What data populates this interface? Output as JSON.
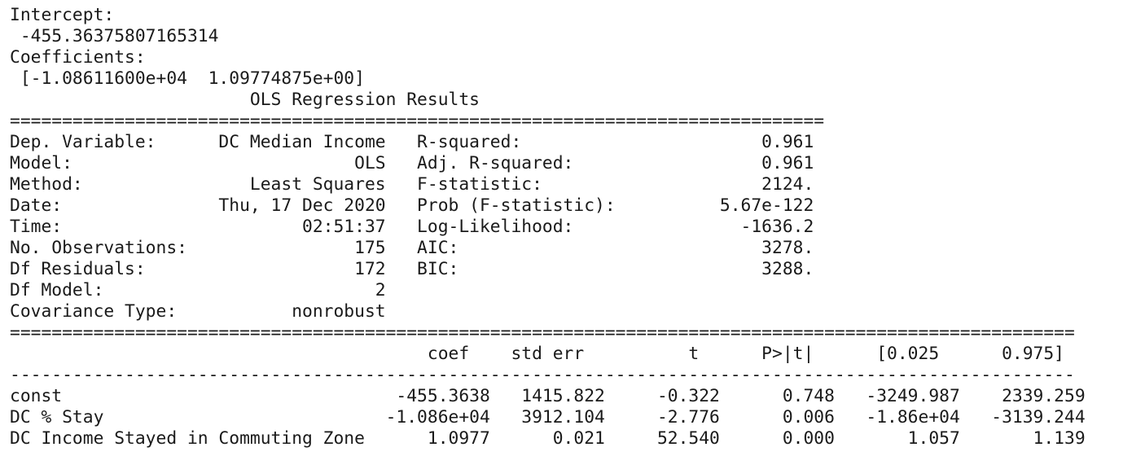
{
  "output": {
    "intercept_label": "Intercept:",
    "intercept_value": " -455.36375807165314",
    "coefficients_label": "Coefficients:",
    "coefficients_value": " [-1.08611600e+04  1.09774875e+00]",
    "summary_title": "                       OLS Regression Results",
    "separator_top": "==============================================================================",
    "model_info_rows": [
      "Dep. Variable:      DC Median Income   R-squared:                       0.961",
      "Model:                           OLS   Adj. R-squared:                  0.961",
      "Method:                Least Squares   F-statistic:                     2124.",
      "Date:               Thu, 17 Dec 2020   Prob (F-statistic):          5.67e-122",
      "Time:                       02:51:37   Log-Likelihood:                -1636.2",
      "No. Observations:                175   AIC:                             3278.",
      "Df Residuals:                    172   BIC:                             3288.",
      "Df Model:                          2",
      "Covariance Type:           nonrobust"
    ],
    "separator_wide": "======================================================================================================",
    "coef_header": "                                        coef    std err          t      P>|t|      [0.025      0.975]",
    "separator_dash": "------------------------------------------------------------------------------------------------------",
    "coef_rows": [
      "const                                -455.3638   1415.822     -0.322      0.748   -3249.987    2339.259",
      "DC % Stay                           -1.086e+04   3912.104     -2.776      0.006   -1.86e+04   -3139.244",
      "DC Income Stayed in Commuting Zone      1.0977      0.021     52.540      0.000       1.057       1.139"
    ]
  }
}
